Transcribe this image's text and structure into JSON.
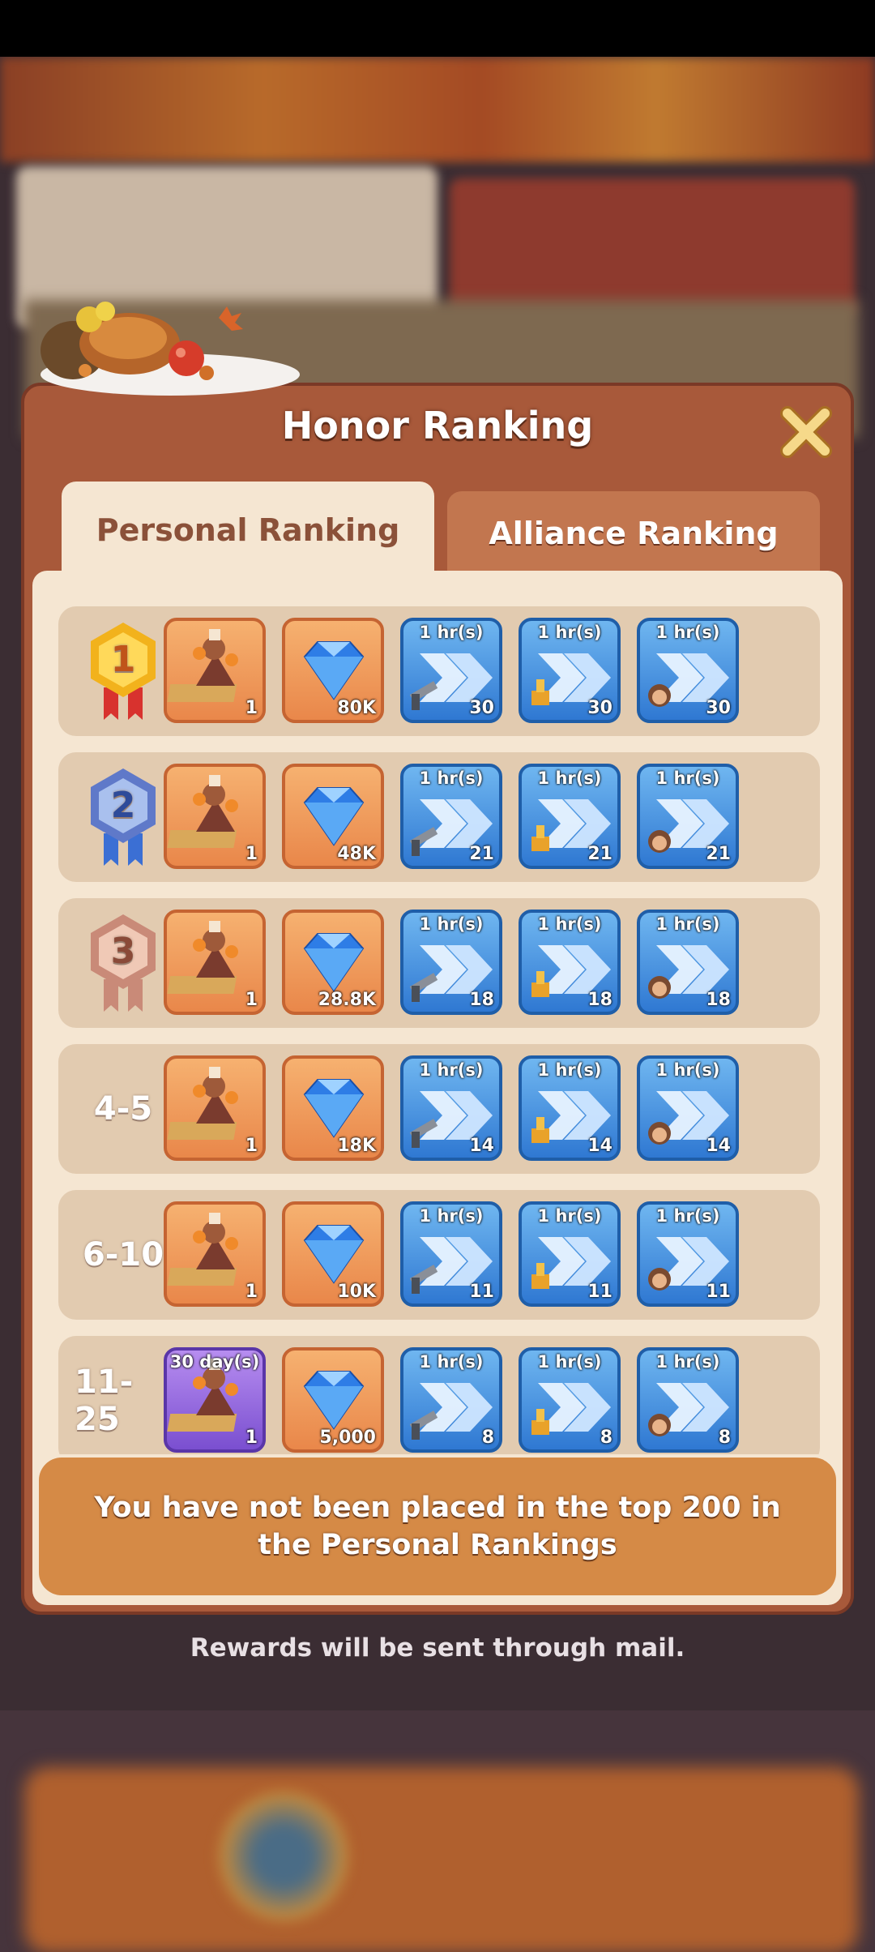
{
  "dialog": {
    "title": "Honor Ranking",
    "tabs": [
      {
        "label": "Personal Ranking",
        "active": true
      },
      {
        "label": "Alliance Ranking",
        "active": false
      }
    ],
    "rows": [
      {
        "rank": "1",
        "rank_type": "gold-medal",
        "items": [
          {
            "kind": "building-decoration",
            "style": "orange",
            "qty": "1"
          },
          {
            "kind": "gems",
            "style": "orange",
            "qty": "80K"
          },
          {
            "kind": "speedup-sword",
            "style": "blue",
            "duration": "1 hr(s)",
            "qty": "30"
          },
          {
            "kind": "speedup-research",
            "style": "blue",
            "duration": "1 hr(s)",
            "qty": "30"
          },
          {
            "kind": "speedup-training",
            "style": "blue",
            "duration": "1 hr(s)",
            "qty": "30"
          }
        ]
      },
      {
        "rank": "2",
        "rank_type": "silver-medal",
        "items": [
          {
            "kind": "building-decoration",
            "style": "orange",
            "qty": "1"
          },
          {
            "kind": "gems",
            "style": "orange",
            "qty": "48K"
          },
          {
            "kind": "speedup-sword",
            "style": "blue",
            "duration": "1 hr(s)",
            "qty": "21"
          },
          {
            "kind": "speedup-research",
            "style": "blue",
            "duration": "1 hr(s)",
            "qty": "21"
          },
          {
            "kind": "speedup-training",
            "style": "blue",
            "duration": "1 hr(s)",
            "qty": "21"
          }
        ]
      },
      {
        "rank": "3",
        "rank_type": "bronze-medal",
        "items": [
          {
            "kind": "building-decoration",
            "style": "orange",
            "qty": "1"
          },
          {
            "kind": "gems",
            "style": "orange",
            "qty": "28.8K"
          },
          {
            "kind": "speedup-sword",
            "style": "blue",
            "duration": "1 hr(s)",
            "qty": "18"
          },
          {
            "kind": "speedup-research",
            "style": "blue",
            "duration": "1 hr(s)",
            "qty": "18"
          },
          {
            "kind": "speedup-training",
            "style": "blue",
            "duration": "1 hr(s)",
            "qty": "18"
          }
        ]
      },
      {
        "rank": "4-5",
        "rank_type": "text",
        "items": [
          {
            "kind": "building-decoration",
            "style": "orange",
            "qty": "1"
          },
          {
            "kind": "gems",
            "style": "orange",
            "qty": "18K"
          },
          {
            "kind": "speedup-sword",
            "style": "blue",
            "duration": "1 hr(s)",
            "qty": "14"
          },
          {
            "kind": "speedup-research",
            "style": "blue",
            "duration": "1 hr(s)",
            "qty": "14"
          },
          {
            "kind": "speedup-training",
            "style": "blue",
            "duration": "1 hr(s)",
            "qty": "14"
          }
        ]
      },
      {
        "rank": "6-10",
        "rank_type": "text",
        "items": [
          {
            "kind": "building-decoration",
            "style": "orange",
            "qty": "1"
          },
          {
            "kind": "gems",
            "style": "orange",
            "qty": "10K"
          },
          {
            "kind": "speedup-sword",
            "style": "blue",
            "duration": "1 hr(s)",
            "qty": "11"
          },
          {
            "kind": "speedup-research",
            "style": "blue",
            "duration": "1 hr(s)",
            "qty": "11"
          },
          {
            "kind": "speedup-training",
            "style": "blue",
            "duration": "1 hr(s)",
            "qty": "11"
          }
        ]
      },
      {
        "rank": "11-25",
        "rank_type": "text",
        "items": [
          {
            "kind": "building-decoration",
            "style": "purple",
            "duration": "30 day(s)",
            "qty": "1"
          },
          {
            "kind": "gems",
            "style": "orange",
            "qty": "5,000"
          },
          {
            "kind": "speedup-sword",
            "style": "blue",
            "duration": "1 hr(s)",
            "qty": "8"
          },
          {
            "kind": "speedup-research",
            "style": "blue",
            "duration": "1 hr(s)",
            "qty": "8"
          },
          {
            "kind": "speedup-training",
            "style": "blue",
            "duration": "1 hr(s)",
            "qty": "8"
          }
        ]
      }
    ],
    "notice": "You have not been placed in the top 200 in the Personal Rankings"
  },
  "footer": "Rewards will be sent through mail.",
  "colors": {
    "dialog_frame": "#a8593a",
    "panel": "#f5e6d2",
    "row": "#e2cbb0",
    "notice": "#d58a46",
    "close_x": "#f6d98a"
  }
}
